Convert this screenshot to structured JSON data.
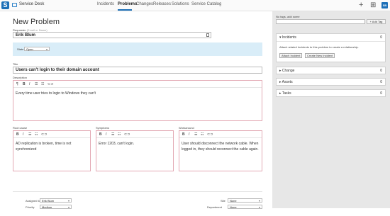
{
  "topbar": {
    "logo_letter": "S",
    "app_name": "Service Desk",
    "nav": [
      "Incidents",
      "Problems",
      "Changes",
      "Releases",
      "Solutions",
      "Service Catalog"
    ],
    "active_nav": "Problems",
    "plus": "+",
    "grid": "⊞",
    "avatar": "SB"
  },
  "form": {
    "title": "New Problem",
    "requester_label": "Requester",
    "requester_hint": "(Email or Name)",
    "requester_value": "Erik Blum",
    "state_label": "State",
    "state_value": "Open",
    "title_label": "Title",
    "title_value": "Users can't login to their domain account",
    "description_label": "Description",
    "description_value": "Every time user tries to login to Windows they can't",
    "root_cause_label": "Root cause",
    "root_cause_value": "AD replication is broken, time is not synchronized",
    "symptoms_label": "Symptoms",
    "symptoms_value": "Error 1203, can't login.",
    "workaround_label": "Workaround",
    "workaround_value": "User should disconnect the network cable. When logged in, they should reconnect the cable again.",
    "assigned_label": "Assigned to",
    "assigned_value": "Erik Blum",
    "priority_label": "Priority",
    "priority_value": "Medium",
    "site_label": "Site",
    "site_value": "None",
    "department_label": "Department",
    "department_value": "None"
  },
  "toolbar": {
    "paragraph": "¶",
    "bold": "B",
    "italic": "I",
    "bullets": "☰",
    "numbered": "☷",
    "link": "⊂⊃"
  },
  "sidebar": {
    "tags_label": "No tags, add some",
    "add_tag_button": "+ Add Tag",
    "incidents": {
      "title": "Incidents",
      "count": "0",
      "description": "Attach related Incidents to this problem to create a relationship.",
      "attach_button": "Attach Incident",
      "create_button": "Create New Incident"
    },
    "change": {
      "title": "Change",
      "count": "0"
    },
    "assets": {
      "title": "Assets",
      "count": "0"
    },
    "tasks": {
      "title": "Tasks",
      "count": "0"
    }
  }
}
